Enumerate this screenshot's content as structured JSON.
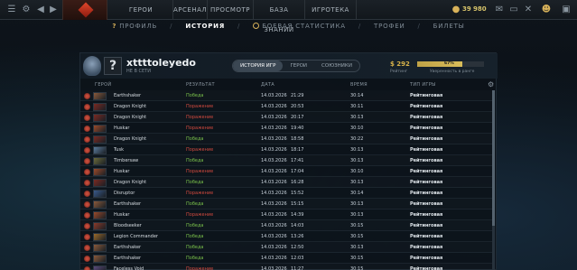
{
  "topbar": {
    "nav": [
      "ГЕРОИ",
      "АРСЕНАЛ",
      "ПРОСМОТР",
      "БАЗА ЗНАНИЙ",
      "ИГРОТЕКА"
    ],
    "tray_value_1": "39",
    "tray_value_2": "980"
  },
  "subnav": {
    "items": [
      "ПРОФИЛЬ",
      "ИСТОРИЯ",
      "БОЕВАЯ СТАТИСТИКА",
      "ТРОФЕИ",
      "БИЛЕТЫ"
    ]
  },
  "profile": {
    "username": "xttttoleyedo",
    "status": "НЕ В СЕТИ",
    "avatar_glyph": "?",
    "tabs": [
      "ИСТОРИЯ ИГР",
      "ГЕРОИ",
      "СОЮЗНИКИ"
    ],
    "rating_value": "$ 292",
    "rating_label": "Рейтинг",
    "confidence_value": "67%",
    "confidence_fraction": 0.67,
    "confidence_label": "Уверенность в ранге"
  },
  "table": {
    "headers": [
      "ГЕРОЙ",
      "РЕЗУЛЬТАТ",
      "ДАТА",
      "ВРЕМЯ",
      "ТИП ИГРЫ"
    ],
    "rows": [
      {
        "hero": "Earthshaker",
        "result": "Победа",
        "date": "14.03.2026",
        "time": "21:29",
        "duration": "30:14",
        "type": "Рейтинговая",
        "win": true,
        "color": "#8a5a3a"
      },
      {
        "hero": "Dragon Knight",
        "result": "Поражение",
        "date": "14.03.2026",
        "time": "20:53",
        "duration": "30:11",
        "type": "Рейтинговая",
        "win": false,
        "color": "#7a2a22"
      },
      {
        "hero": "Dragon Knight",
        "result": "Поражение",
        "date": "14.03.2026",
        "time": "20:17",
        "duration": "30:13",
        "type": "Рейтинговая",
        "win": false,
        "color": "#7a2a22"
      },
      {
        "hero": "Huskar",
        "result": "Поражение",
        "date": "14.03.2026",
        "time": "19:40",
        "duration": "30:10",
        "type": "Рейтинговая",
        "win": false,
        "color": "#9a4a2a"
      },
      {
        "hero": "Dragon Knight",
        "result": "Победа",
        "date": "14.03.2026",
        "time": "18:58",
        "duration": "30:22",
        "type": "Рейтинговая",
        "win": true,
        "color": "#7a2a22"
      },
      {
        "hero": "Tusk",
        "result": "Поражение",
        "date": "14.03.2026",
        "time": "18:17",
        "duration": "30:13",
        "type": "Рейтинговая",
        "win": false,
        "color": "#5a7a9a"
      },
      {
        "hero": "Timbersaw",
        "result": "Победа",
        "date": "14.03.2026",
        "time": "17:41",
        "duration": "30:13",
        "type": "Рейтинговая",
        "win": true,
        "color": "#6a6a3a"
      },
      {
        "hero": "Huskar",
        "result": "Поражение",
        "date": "14.03.2026",
        "time": "17:04",
        "duration": "30:10",
        "type": "Рейтинговая",
        "win": false,
        "color": "#9a4a2a"
      },
      {
        "hero": "Dragon Knight",
        "result": "Победа",
        "date": "14.03.2026",
        "time": "16:28",
        "duration": "30:13",
        "type": "Рейтинговая",
        "win": true,
        "color": "#7a2a22"
      },
      {
        "hero": "Disruptor",
        "result": "Поражение",
        "date": "14.03.2026",
        "time": "15:52",
        "duration": "30:14",
        "type": "Рейтинговая",
        "win": false,
        "color": "#3a5a8a"
      },
      {
        "hero": "Earthshaker",
        "result": "Победа",
        "date": "14.03.2026",
        "time": "15:15",
        "duration": "30:13",
        "type": "Рейтинговая",
        "win": true,
        "color": "#8a5a3a"
      },
      {
        "hero": "Huskar",
        "result": "Поражение",
        "date": "14.03.2026",
        "time": "14:39",
        "duration": "30:13",
        "type": "Рейтинговая",
        "win": false,
        "color": "#9a4a2a"
      },
      {
        "hero": "Bloodseeker",
        "result": "Победа",
        "date": "14.03.2026",
        "time": "14:03",
        "duration": "30:15",
        "type": "Рейтинговая",
        "win": true,
        "color": "#8a3a2a"
      },
      {
        "hero": "Legion Commander",
        "result": "Победа",
        "date": "14.03.2026",
        "time": "13:26",
        "duration": "30:15",
        "type": "Рейтинговая",
        "win": true,
        "color": "#9a6a2a"
      },
      {
        "hero": "Earthshaker",
        "result": "Победа",
        "date": "14.03.2026",
        "time": "12:50",
        "duration": "30:13",
        "type": "Рейтинговая",
        "win": true,
        "color": "#8a5a3a"
      },
      {
        "hero": "Earthshaker",
        "result": "Победа",
        "date": "14.03.2026",
        "time": "12:03",
        "duration": "30:15",
        "type": "Рейтинговая",
        "win": true,
        "color": "#8a5a3a"
      },
      {
        "hero": "Faceless Void",
        "result": "Поражение",
        "date": "14.03.2026",
        "time": "11:27",
        "duration": "30:15",
        "type": "Рейтинговая",
        "win": false,
        "color": "#5a4a7a"
      }
    ]
  }
}
